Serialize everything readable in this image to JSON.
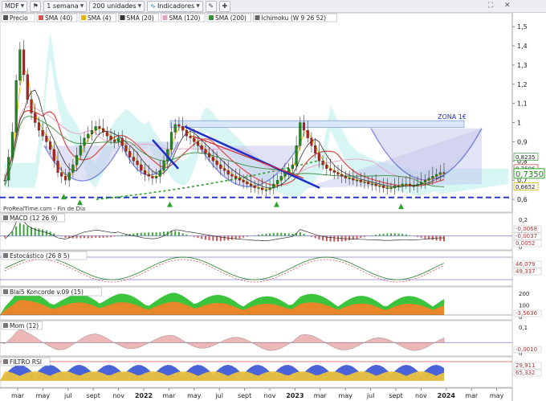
{
  "toolbar": {
    "symbol": "MDF",
    "period": "1 semana",
    "units": "200 unidades",
    "indicators": "Indicadores",
    "icon_names": [
      "tag-icon",
      "pen-icon",
      "crosshair-icon",
      "fullscreen-icon",
      "close-icon"
    ]
  },
  "colors": {
    "candle_up": "#1c8a1c",
    "candle_down": "#b52222",
    "sma40": "#d9534f",
    "sma4": "#e4b400",
    "sma20": "#333333",
    "sma120": "#e6a0c4",
    "sma200": "#3a8f3a",
    "cloud_a": "#b6ede9",
    "cloud_b": "#d9d9d9",
    "trend_blue": "#1c2fc9",
    "zone": "#dbe8fb"
  },
  "main_legend": [
    {
      "label": "Precio",
      "swatch": "#555555"
    },
    {
      "label": "SMA (40)",
      "swatch": "#d9534f"
    },
    {
      "label": "SMA (4)",
      "swatch": "#e4b400"
    },
    {
      "label": "SMA (20)",
      "swatch": "#333333"
    },
    {
      "label": "SMA (120)",
      "swatch": "#e6a0c4"
    },
    {
      "label": "SMA (200)",
      "swatch": "#3a8f3a"
    },
    {
      "label": "Ichimoku (W 9 26 52)",
      "swatch": "#666666"
    }
  ],
  "zone_label": "ZONA 1€",
  "source_label": "ProRealTime.com - Fin de Día",
  "panels": [
    {
      "key": "macd",
      "title": "MACD (12 26 9)",
      "ticks": [
        "0,2",
        "0,1",
        "0"
      ],
      "values": [
        "0,0052",
        "-0,0037",
        "-0,0068"
      ]
    },
    {
      "key": "stoch",
      "title": "Estocástico (26 8 5)",
      "ticks": [],
      "values": [
        "49,337",
        "46,079"
      ]
    },
    {
      "key": "koncorde",
      "title": "Blai5 Koncorde v.09 (15)",
      "ticks": [
        "200",
        "100",
        "0"
      ],
      "values": [
        "-3,5636"
      ]
    },
    {
      "key": "mom",
      "title": "Mom (12)",
      "ticks": [
        "0,1",
        "0"
      ],
      "values": [
        "-0,0010"
      ]
    },
    {
      "key": "rsi",
      "title": "FILTRO RSI",
      "ticks": [],
      "values": [
        "65,332",
        "29,911"
      ]
    }
  ],
  "chart_data": {
    "type": "candlestick",
    "title": "",
    "x_axis_labels": [
      "mar",
      "may",
      "jul",
      "sept",
      "nov",
      "2022",
      "mar",
      "may",
      "jul",
      "sept",
      "nov",
      "2023",
      "mar",
      "may",
      "jul",
      "sept",
      "nov",
      "2024",
      "mar",
      "may"
    ],
    "y_ticks": [
      1.5,
      1.4,
      1.3,
      1.2,
      1.1,
      1,
      0.9,
      0.8,
      0.7,
      0.6
    ],
    "y_tick_labels": [
      "1,5",
      "1,4",
      "1,3",
      "1,2",
      "1,1",
      "1",
      "0,9",
      "0,8",
      "0,7",
      "0,6"
    ],
    "ylim": [
      0.55,
      1.53
    ],
    "last_price_label": "0,7350",
    "right_price_labels": [
      "0,8235",
      "0,7596",
      "0,6652"
    ],
    "support_level": 0.61,
    "zone_range": [
      0.975,
      1.01
    ],
    "close_series": [
      0.7,
      0.82,
      0.95,
      1.22,
      1.38,
      1.25,
      1.12,
      1.05,
      1.0,
      0.96,
      0.93,
      0.9,
      0.86,
      0.8,
      0.74,
      0.72,
      0.7,
      0.74,
      0.78,
      0.83,
      0.88,
      0.92,
      0.94,
      0.96,
      0.98,
      0.97,
      0.95,
      0.93,
      0.91,
      0.9,
      0.92,
      0.88,
      0.85,
      0.82,
      0.8,
      0.78,
      0.75,
      0.73,
      0.72,
      0.71,
      0.72,
      0.75,
      0.8,
      0.86,
      0.95,
      0.99,
      0.98,
      0.96,
      0.93,
      0.92,
      0.9,
      0.88,
      0.86,
      0.84,
      0.82,
      0.8,
      0.78,
      0.76,
      0.75,
      0.73,
      0.72,
      0.71,
      0.7,
      0.69,
      0.68,
      0.67,
      0.66,
      0.66,
      0.65,
      0.65,
      0.66,
      0.68,
      0.7,
      0.72,
      0.74,
      0.76,
      0.78,
      0.88,
      1.0,
      0.96,
      0.92,
      0.88,
      0.84,
      0.8,
      0.78,
      0.76,
      0.75,
      0.74,
      0.73,
      0.72,
      0.71,
      0.71,
      0.7,
      0.7,
      0.69,
      0.69,
      0.68,
      0.68,
      0.67,
      0.67,
      0.66,
      0.66,
      0.66,
      0.67,
      0.67,
      0.68,
      0.68,
      0.67,
      0.67,
      0.68,
      0.69,
      0.7,
      0.71,
      0.72,
      0.73,
      0.74,
      0.735
    ]
  }
}
